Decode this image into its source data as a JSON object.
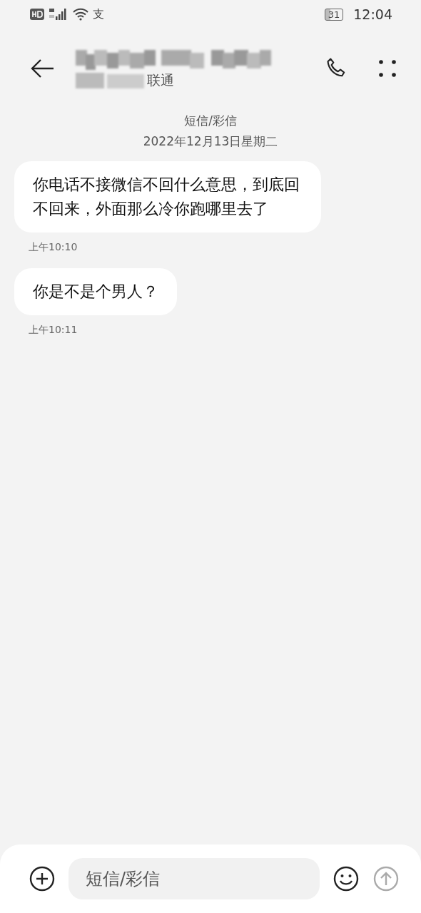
{
  "status_bar": {
    "notification_glyph": "支",
    "battery": "31",
    "time": "12:04"
  },
  "header": {
    "carrier": "联通"
  },
  "thread": {
    "channel": "短信/彩信",
    "date": "2022年12月13日星期二"
  },
  "messages": [
    {
      "text": "你电话不接微信不回什么意思，到底回不回来，外面那么冷你跑哪里去了",
      "time": "上午10:10"
    },
    {
      "text": "你是不是个男人？",
      "time": "上午10:11"
    }
  ],
  "composer": {
    "placeholder": "短信/彩信",
    "send_disabled": true
  }
}
